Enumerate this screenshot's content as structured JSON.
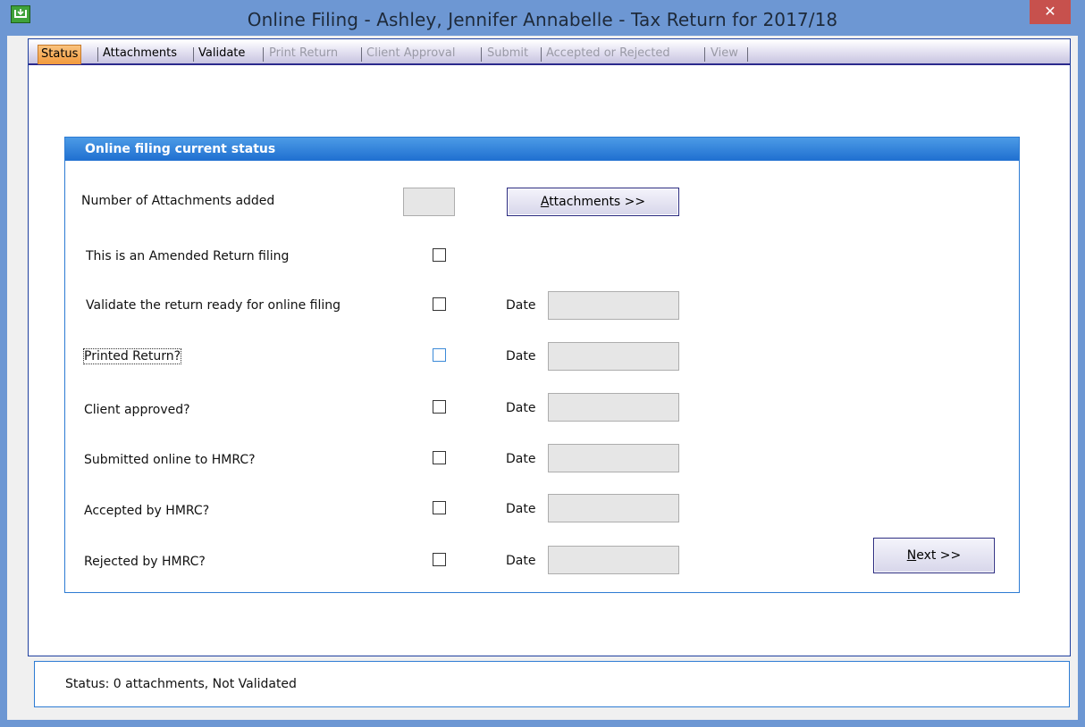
{
  "window": {
    "title": "Online Filing - Ashley, Jennifer Annabelle - Tax Return for 2017/18",
    "close_glyph": "✕",
    "icon": "app-icon"
  },
  "tabs": [
    {
      "label": "Status",
      "state": "active"
    },
    {
      "label": "Attachments",
      "state": "enabled"
    },
    {
      "label": "Validate",
      "state": "enabled"
    },
    {
      "label": "Print Return",
      "state": "disabled"
    },
    {
      "label": "Client Approval",
      "state": "disabled"
    },
    {
      "label": "Submit",
      "state": "disabled"
    },
    {
      "label": "Accepted or Rejected",
      "state": "disabled"
    },
    {
      "label": "View",
      "state": "disabled"
    }
  ],
  "panel": {
    "title": "Online filing current status",
    "attachments_row": {
      "label": "Number of Attachments added",
      "count_value": "",
      "button_accel": "A",
      "button_rest": "ttachments >>"
    },
    "rows": [
      {
        "label": "This is an Amended Return filing",
        "checked": false,
        "date_label": "",
        "date_value": ""
      },
      {
        "label": "Validate the return ready for online filing",
        "checked": false,
        "date_label": "Date",
        "date_value": ""
      },
      {
        "label": "Printed Return?",
        "checked": false,
        "date_label": "Date",
        "date_value": ""
      },
      {
        "label": "Client approved?",
        "checked": false,
        "date_label": "Date",
        "date_value": ""
      },
      {
        "label": "Submitted online to HMRC?",
        "checked": false,
        "date_label": "Date",
        "date_value": ""
      },
      {
        "label": "Accepted by HMRC?",
        "checked": false,
        "date_label": "Date",
        "date_value": ""
      },
      {
        "label": "Rejected by HMRC?",
        "checked": false,
        "date_label": "Date",
        "date_value": ""
      }
    ],
    "next_button": {
      "accel": "N",
      "rest": "ext >>"
    }
  },
  "status_bar": {
    "text": "Status: 0 attachments, Not Validated"
  },
  "colors": {
    "frame": "#6d97d3",
    "close": "#c7514d",
    "active_tab": "#f29a3c",
    "group_header": "#1f6fd0"
  }
}
